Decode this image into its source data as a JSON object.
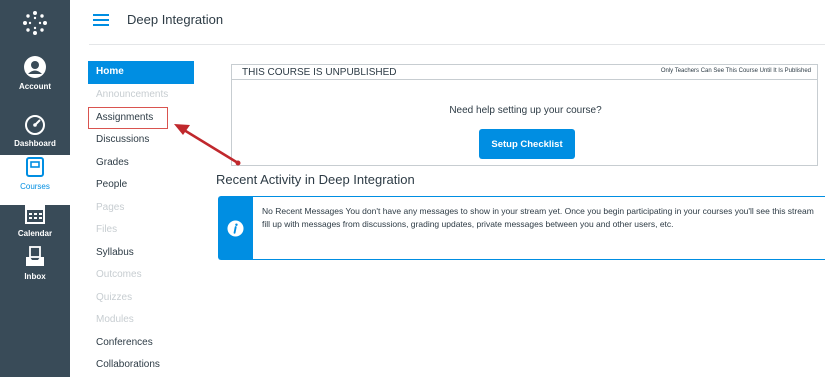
{
  "global_nav": {
    "items": [
      {
        "label": "Account",
        "icon": "account-icon"
      },
      {
        "label": "Dashboard",
        "icon": "dashboard-icon"
      },
      {
        "label": "Courses",
        "icon": "courses-icon",
        "active": true
      },
      {
        "label": "Calendar",
        "icon": "calendar-icon"
      },
      {
        "label": "Inbox",
        "icon": "inbox-icon"
      }
    ]
  },
  "header": {
    "breadcrumb": "Deep Integration"
  },
  "course_nav": {
    "items": [
      {
        "label": "Home",
        "state": "active"
      },
      {
        "label": "Announcements",
        "state": "disabled"
      },
      {
        "label": "Assignments",
        "state": "highlighted"
      },
      {
        "label": "Discussions",
        "state": "normal"
      },
      {
        "label": "Grades",
        "state": "normal"
      },
      {
        "label": "People",
        "state": "normal"
      },
      {
        "label": "Pages",
        "state": "disabled"
      },
      {
        "label": "Files",
        "state": "disabled"
      },
      {
        "label": "Syllabus",
        "state": "normal"
      },
      {
        "label": "Outcomes",
        "state": "disabled"
      },
      {
        "label": "Quizzes",
        "state": "disabled"
      },
      {
        "label": "Modules",
        "state": "disabled"
      },
      {
        "label": "Conferences",
        "state": "normal"
      },
      {
        "label": "Collaborations",
        "state": "normal"
      }
    ]
  },
  "unpublished": {
    "title": "THIS COURSE IS UNPUBLISHED",
    "note": "Only Teachers Can See This Course Until It Is Published",
    "help_text": "Need help setting up your course?",
    "button_label": "Setup Checklist"
  },
  "recent_activity": {
    "title": "Recent Activity in Deep Integration",
    "message": "No Recent Messages  You don't have any messages to show in your stream yet. Once you begin participating in your courses you'll see this stream fill up with messages from discussions, grading updates, private messages between you and other users, etc."
  },
  "colors": {
    "accent": "#008ee2",
    "nav_background": "#394b58",
    "annotation": "#c0282d"
  }
}
